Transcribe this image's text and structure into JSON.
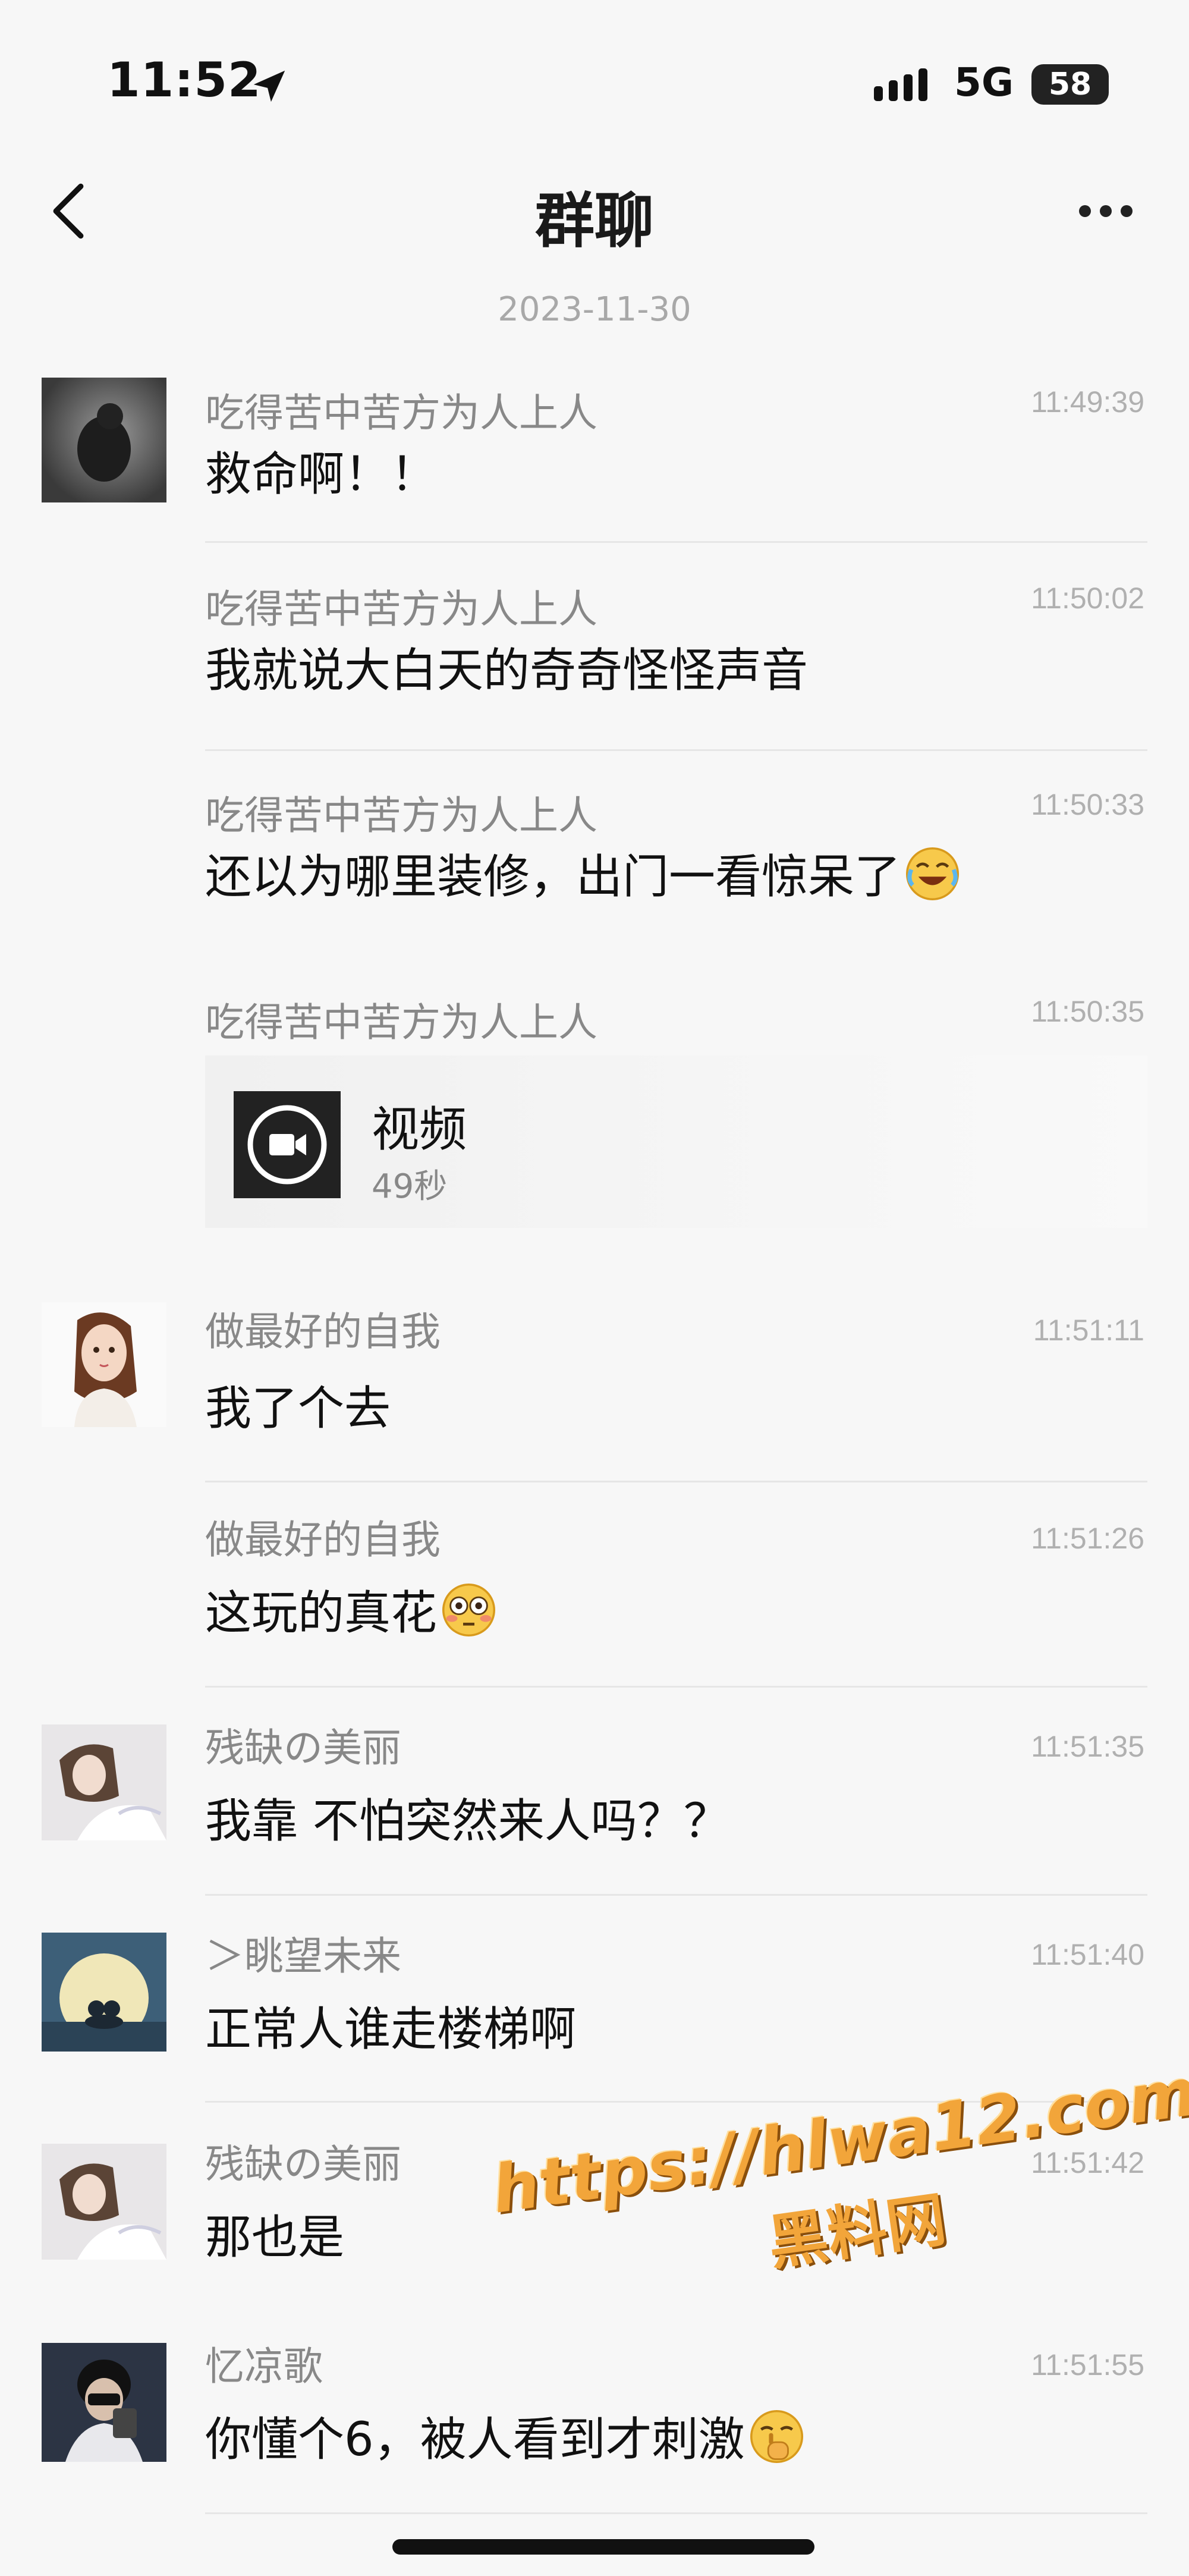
{
  "status_bar": {
    "time": "11:52",
    "network": "5G",
    "battery": "58"
  },
  "nav": {
    "title": "群聊"
  },
  "date_divider": "2023-11-30",
  "messages": [
    {
      "sender": "吃得苦中苦方为人上人",
      "time": "11:49:39",
      "text": "救命啊！！"
    },
    {
      "sender": "吃得苦中苦方为人上人",
      "time": "11:50:02",
      "text": "我就说大白天的奇奇怪怪声音"
    },
    {
      "sender": "吃得苦中苦方为人上人",
      "time": "11:50:33",
      "text": "还以为哪里装修，出门一看惊呆了",
      "emoji": "laugh-cry-emoji"
    },
    {
      "sender": "吃得苦中苦方为人上人",
      "time": "11:50:35",
      "video_label": "视频",
      "video_duration": "49秒"
    },
    {
      "sender": "做最好的自我",
      "time": "11:51:11",
      "text": "我了个去"
    },
    {
      "sender": "做最好的自我",
      "time": "11:51:26",
      "text": "这玩的真花",
      "emoji": "flushed-emoji"
    },
    {
      "sender": "残缺の美丽",
      "time": "11:51:35",
      "text": "我靠 不怕突然来人吗？？"
    },
    {
      "sender": "＞眺望未来",
      "time": "11:51:40",
      "text": "正常人谁走楼梯啊"
    },
    {
      "sender": "残缺の美丽",
      "time": "11:51:42",
      "text": "那也是"
    },
    {
      "sender": "忆凉歌",
      "time": "11:51:55",
      "text": "你懂个6，被人看到才刺激",
      "emoji": "shushing-emoji"
    }
  ],
  "watermark": {
    "url": "https://hlwa12.com",
    "name": "黑料网"
  }
}
